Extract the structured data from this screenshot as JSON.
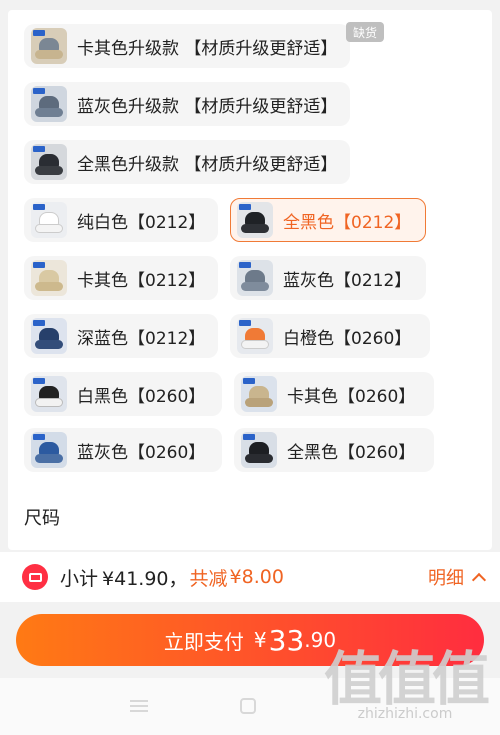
{
  "colors": {
    "accent": "#f06423",
    "pay_start": "#ff7a14",
    "pay_end": "#ff2d3f",
    "ticket_red": "#ff2f43",
    "selected_border": "#f07a36"
  },
  "color_options": [
    {
      "label": "卡其色升级款 【材质升级更舒适】",
      "badge": "缺货",
      "thumb": "khaki"
    },
    {
      "label": "蓝灰色升级款 【材质升级更舒适】",
      "thumb": "bluegray"
    },
    {
      "label": "全黑色升级款 【材质升级更舒适】",
      "thumb": "black"
    },
    {
      "label": "纯白色【0212】",
      "thumb": "white"
    },
    {
      "label": "全黑色【0212】",
      "thumb": "black",
      "selected": true
    },
    {
      "label": "卡其色【0212】",
      "thumb": "khaki"
    },
    {
      "label": "蓝灰色【0212】",
      "thumb": "bluegray"
    },
    {
      "label": "深蓝色【0212】",
      "thumb": "navy"
    },
    {
      "label": "白橙色【0260】",
      "thumb": "orange"
    },
    {
      "label": "白黑色【0260】",
      "thumb": "white"
    },
    {
      "label": "卡其色【0260】",
      "thumb": "khaki"
    },
    {
      "label": "蓝灰色【0260】",
      "thumb": "bluegray"
    },
    {
      "label": "全黑色【0260】",
      "thumb": "black"
    }
  ],
  "size_section": {
    "title": "尺码"
  },
  "summary": {
    "subtotal_label": "小计",
    "subtotal_amount": "¥41.90，",
    "discount_label": "共减",
    "discount_amount": "¥8.00",
    "detail_label": "明细"
  },
  "pay_button": {
    "label": "立即支付",
    "currency": "¥",
    "amount_int": "33",
    "amount_dec": ".90"
  },
  "watermark": {
    "big": "值值值",
    "small": "zhizhizhi.com"
  }
}
